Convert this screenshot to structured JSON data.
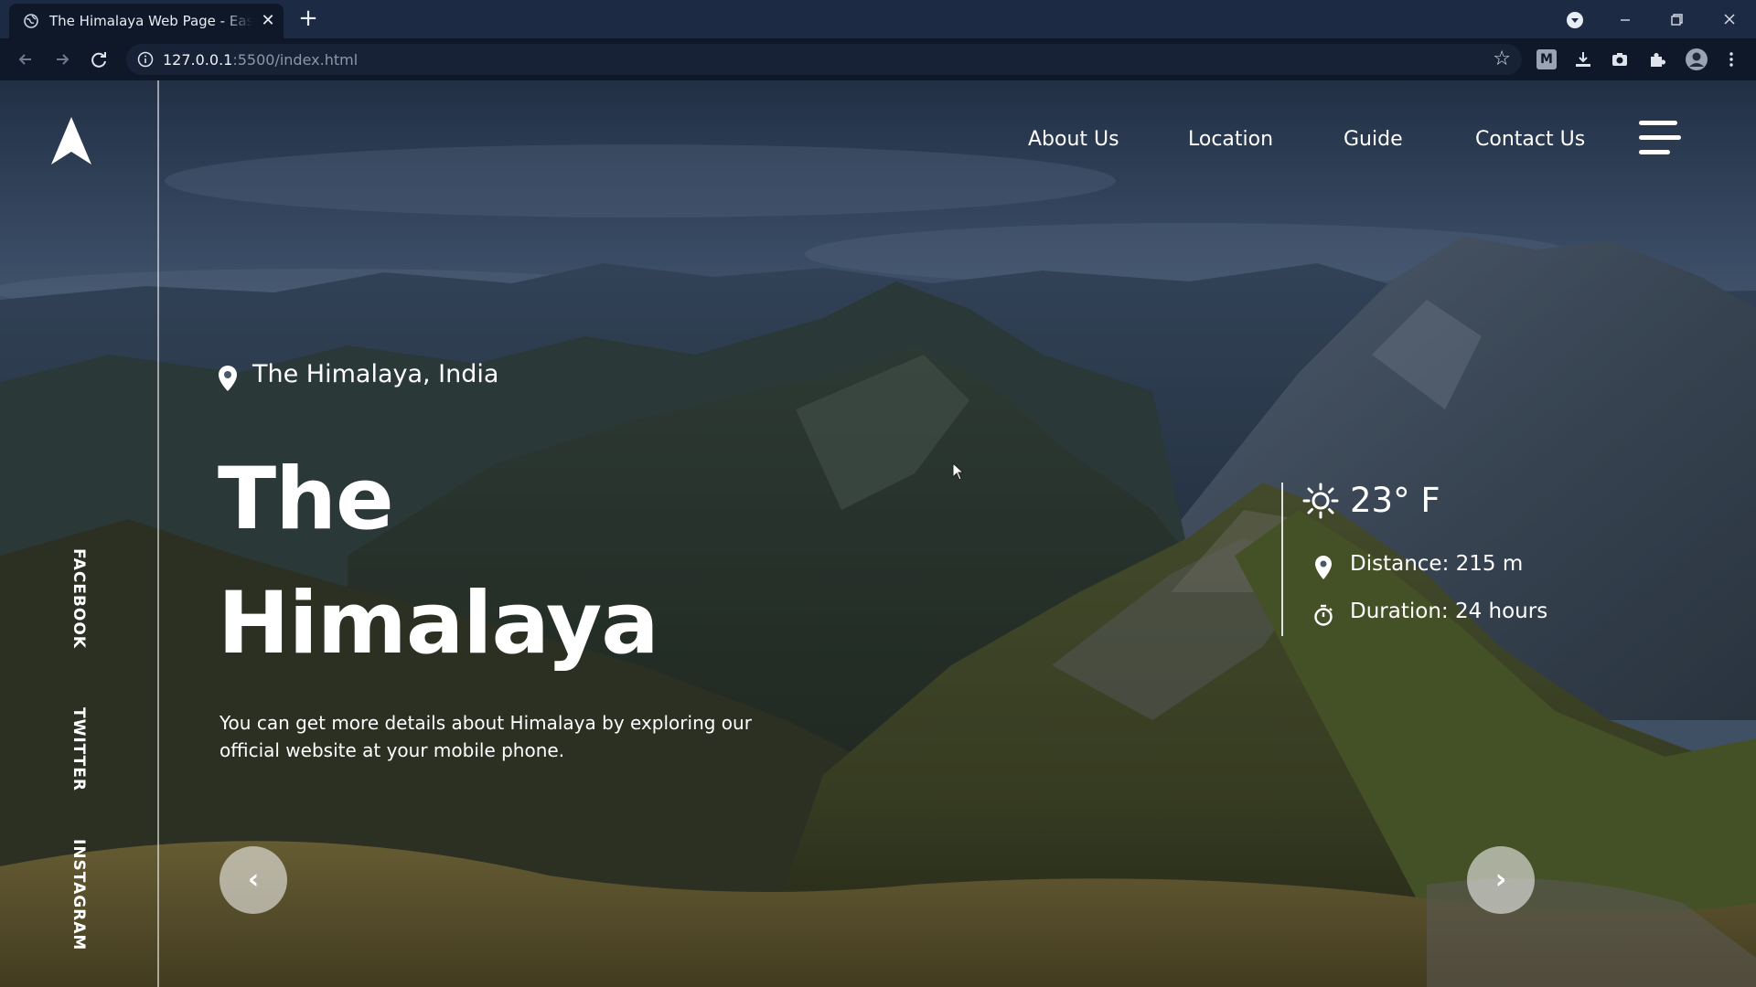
{
  "browser": {
    "tab_title": "The Himalaya Web Page - Easy Tutorials",
    "tab_close": "✕",
    "new_tab": "+",
    "url_host": "127.0.0.1",
    "url_path": ":5500/index.html",
    "extension_m": "M"
  },
  "sidebar": {
    "social": [
      "FACEBOOK",
      "TWITTER",
      "INSTAGRAM"
    ]
  },
  "nav": {
    "items": [
      "About Us",
      "Location",
      "Guide",
      "Contact Us"
    ]
  },
  "hero": {
    "location": "The Himalaya, India",
    "title_line1": "The",
    "title_line2": "Himalaya",
    "description": "You can get more details about Himalaya by exploring our official website at your mobile phone."
  },
  "info": {
    "temperature": "23° F",
    "distance": "Distance: 215 m",
    "duration": "Duration: 24 hours"
  },
  "controls": {
    "prev": "‹",
    "next": "›"
  }
}
